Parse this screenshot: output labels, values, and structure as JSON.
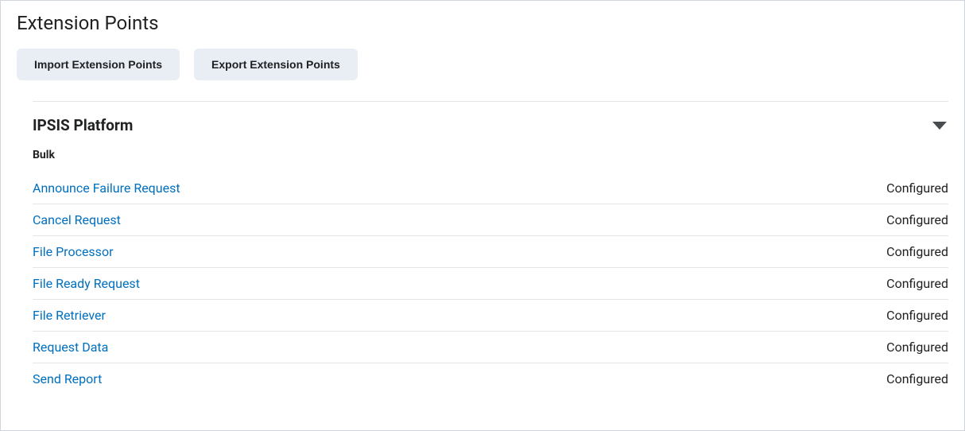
{
  "page": {
    "title": "Extension Points"
  },
  "toolbar": {
    "import_label": "Import Extension Points",
    "export_label": "Export Extension Points"
  },
  "section": {
    "title": "IPSIS Platform",
    "subheading": "Bulk",
    "items": [
      {
        "label": "Announce Failure Request",
        "status": "Configured"
      },
      {
        "label": "Cancel Request",
        "status": "Configured"
      },
      {
        "label": "File Processor",
        "status": "Configured"
      },
      {
        "label": "File Ready Request",
        "status": "Configured"
      },
      {
        "label": "File Retriever",
        "status": "Configured"
      },
      {
        "label": "Request Data",
        "status": "Configured"
      },
      {
        "label": "Send Report",
        "status": "Configured"
      }
    ]
  }
}
